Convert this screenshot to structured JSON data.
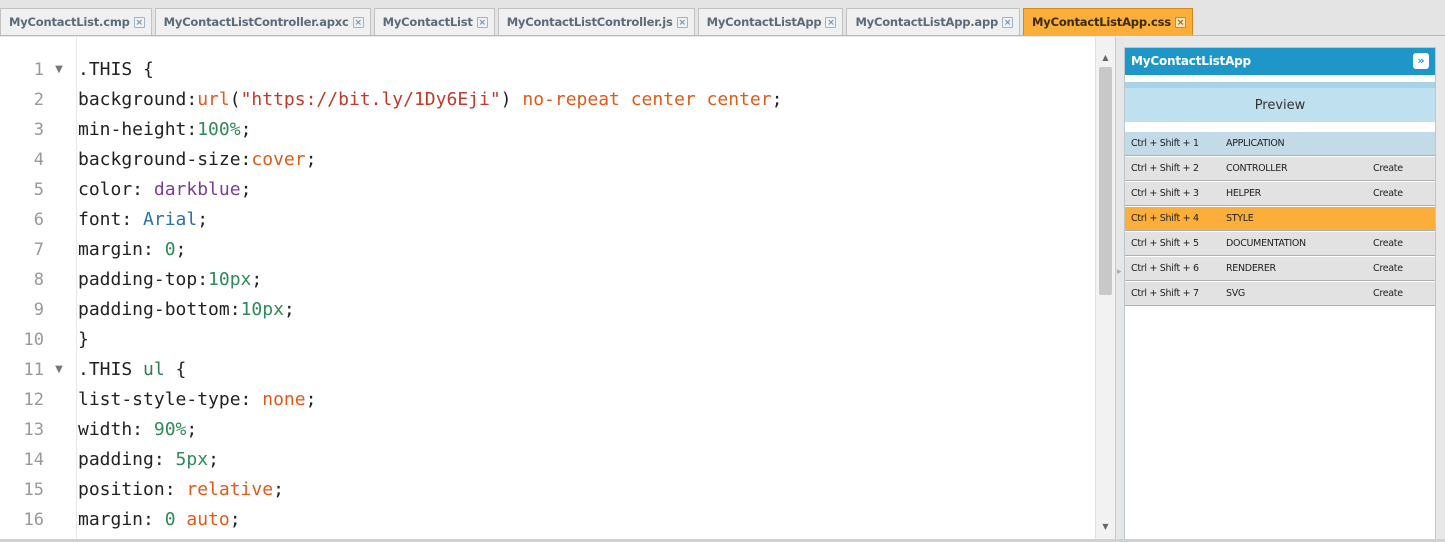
{
  "tabs": [
    {
      "label": "MyContactList.cmp",
      "active": false
    },
    {
      "label": "MyContactListController.apxc",
      "active": false
    },
    {
      "label": "MyContactList",
      "active": false
    },
    {
      "label": "MyContactListController.js",
      "active": false
    },
    {
      "label": "MyContactListApp",
      "active": false
    },
    {
      "label": "MyContactListApp.app",
      "active": false
    },
    {
      "label": "MyContactListApp.css",
      "active": true
    }
  ],
  "tab_close_glyph": "×",
  "editor": {
    "lines": [
      {
        "n": "1",
        "fold": true,
        "tokens": [
          [
            ".THIS {",
            "plain"
          ]
        ]
      },
      {
        "n": "2",
        "fold": false,
        "tokens": [
          [
            "background:",
            "prop"
          ],
          [
            "url",
            "kw"
          ],
          [
            "(",
            "plain"
          ],
          [
            "\"https://bit.ly/1Dy6Eji\"",
            "str"
          ],
          [
            ")",
            "plain"
          ],
          [
            " no-repeat center center",
            "kw"
          ],
          [
            ";",
            "plain"
          ]
        ]
      },
      {
        "n": "3",
        "fold": false,
        "tokens": [
          [
            "min-height:",
            "prop"
          ],
          [
            "100%",
            "num"
          ],
          [
            ";",
            "plain"
          ]
        ]
      },
      {
        "n": "4",
        "fold": false,
        "tokens": [
          [
            "background-size:",
            "prop"
          ],
          [
            "cover",
            "kw"
          ],
          [
            ";",
            "plain"
          ]
        ]
      },
      {
        "n": "5",
        "fold": false,
        "tokens": [
          [
            "color: ",
            "prop"
          ],
          [
            "darkblue",
            "color"
          ],
          [
            ";",
            "plain"
          ]
        ]
      },
      {
        "n": "6",
        "fold": false,
        "tokens": [
          [
            "font: ",
            "prop"
          ],
          [
            "Arial",
            "font"
          ],
          [
            ";",
            "plain"
          ]
        ]
      },
      {
        "n": "7",
        "fold": false,
        "tokens": [
          [
            "margin: ",
            "prop"
          ],
          [
            "0",
            "num"
          ],
          [
            ";",
            "plain"
          ]
        ]
      },
      {
        "n": "8",
        "fold": false,
        "tokens": [
          [
            "padding-top:",
            "prop"
          ],
          [
            "10px",
            "num"
          ],
          [
            ";",
            "plain"
          ]
        ]
      },
      {
        "n": "9",
        "fold": false,
        "tokens": [
          [
            "padding-bottom:",
            "prop"
          ],
          [
            "10px",
            "num"
          ],
          [
            ";",
            "plain"
          ]
        ]
      },
      {
        "n": "10",
        "fold": false,
        "tokens": [
          [
            "}",
            "plain"
          ]
        ]
      },
      {
        "n": "11",
        "fold": true,
        "tokens": [
          [
            ".THIS ",
            "plain"
          ],
          [
            "ul",
            "sel"
          ],
          [
            " {",
            "plain"
          ]
        ]
      },
      {
        "n": "12",
        "fold": false,
        "tokens": [
          [
            "list-style-type: ",
            "prop"
          ],
          [
            "none",
            "kw"
          ],
          [
            ";",
            "plain"
          ]
        ]
      },
      {
        "n": "13",
        "fold": false,
        "tokens": [
          [
            "width: ",
            "prop"
          ],
          [
            "90%",
            "num"
          ],
          [
            ";",
            "plain"
          ]
        ]
      },
      {
        "n": "14",
        "fold": false,
        "tokens": [
          [
            "padding: ",
            "prop"
          ],
          [
            "5px",
            "num"
          ],
          [
            ";",
            "plain"
          ]
        ]
      },
      {
        "n": "15",
        "fold": false,
        "tokens": [
          [
            "position: ",
            "prop"
          ],
          [
            "relative",
            "kw"
          ],
          [
            ";",
            "plain"
          ]
        ]
      },
      {
        "n": "16",
        "fold": false,
        "tokens": [
          [
            "margin: ",
            "prop"
          ],
          [
            "0",
            "num"
          ],
          [
            " auto",
            "kw"
          ],
          [
            ";",
            "plain"
          ]
        ]
      }
    ]
  },
  "panel": {
    "title": "MyContactListApp",
    "expand_glyph": "»",
    "preview_label": "Preview",
    "shortcuts": [
      {
        "keys": "Ctrl + Shift + 1",
        "label": "APPLICATION",
        "action": "",
        "state": "app"
      },
      {
        "keys": "Ctrl + Shift + 2",
        "label": "CONTROLLER",
        "action": "Create",
        "state": ""
      },
      {
        "keys": "Ctrl + Shift + 3",
        "label": "HELPER",
        "action": "Create",
        "state": ""
      },
      {
        "keys": "Ctrl + Shift + 4",
        "label": "STYLE",
        "action": "",
        "state": "active"
      },
      {
        "keys": "Ctrl + Shift + 5",
        "label": "DOCUMENTATION",
        "action": "Create",
        "state": ""
      },
      {
        "keys": "Ctrl + Shift + 6",
        "label": "RENDERER",
        "action": "Create",
        "state": ""
      },
      {
        "keys": "Ctrl + Shift + 7",
        "label": "SVG",
        "action": "Create",
        "state": ""
      }
    ]
  },
  "colors": {
    "active_tab": "#fbae3a",
    "panel_header": "#1e96c8",
    "preview_bg": "#bfe0ee"
  }
}
